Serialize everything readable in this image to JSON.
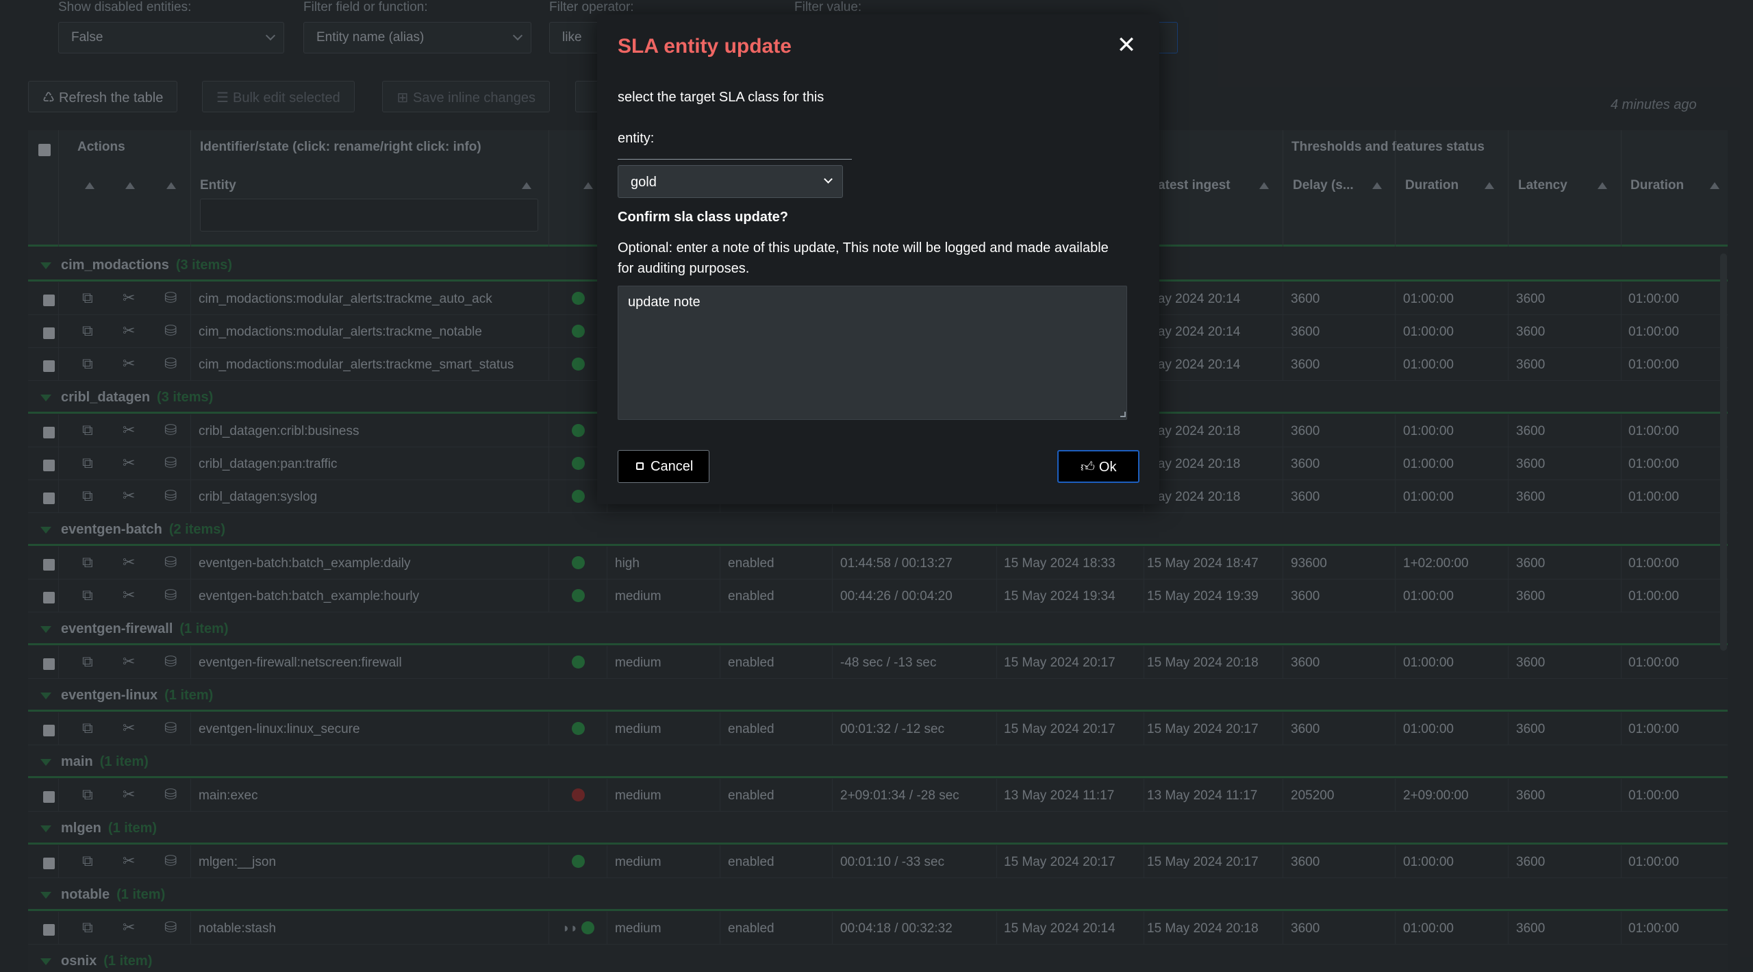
{
  "filters": {
    "show_disabled": {
      "label": "Show disabled entities:",
      "value": "False"
    },
    "filter_field": {
      "label": "Filter field or function:",
      "value": "Entity name (alias)"
    },
    "filter_operator": {
      "label": "Filter operator:",
      "value": "like"
    },
    "filter_value": {
      "label": "Filter value:",
      "value": ""
    }
  },
  "toolbar": {
    "refresh": "Refresh the table",
    "bulk_edit": "Bulk edit selected",
    "save_inline": "Save inline changes",
    "updated": "4 minutes ago"
  },
  "table": {
    "header": {
      "actions": "Actions",
      "identifier": "Identifier/state (click: rename/right click: info)",
      "thresholds": "Thresholds and features status",
      "entity": "Entity",
      "latest_ingest": "atest ingest",
      "delay": "Delay (s...",
      "duration": "Duration",
      "latency": "Latency",
      "duration2": "Duration"
    },
    "groups": [
      {
        "name": "cim_modactions",
        "count": "(3 items)",
        "rows": [
          {
            "entity": "cim_modactions:modular_alerts:trackme_auto_ack",
            "status": "green",
            "priority": "",
            "monitored": "",
            "lag": "",
            "last_event": "",
            "latest_ingest": "May 2024 20:14",
            "delay": "3600",
            "duration": "01:00:00",
            "latency": "3600",
            "duration2": "01:00:00"
          },
          {
            "entity": "cim_modactions:modular_alerts:trackme_notable",
            "status": "green",
            "priority": "",
            "monitored": "",
            "lag": "",
            "last_event": "",
            "latest_ingest": "May 2024 20:14",
            "delay": "3600",
            "duration": "01:00:00",
            "latency": "3600",
            "duration2": "01:00:00"
          },
          {
            "entity": "cim_modactions:modular_alerts:trackme_smart_status",
            "status": "green",
            "priority": "",
            "monitored": "",
            "lag": "",
            "last_event": "",
            "latest_ingest": "May 2024 20:14",
            "delay": "3600",
            "duration": "01:00:00",
            "latency": "3600",
            "duration2": "01:00:00"
          }
        ]
      },
      {
        "name": "cribl_datagen",
        "count": "(3 items)",
        "rows": [
          {
            "entity": "cribl_datagen:cribl:business",
            "status": "green",
            "priority": "",
            "monitored": "",
            "lag": "",
            "last_event": "",
            "latest_ingest": "May 2024 20:18",
            "delay": "3600",
            "duration": "01:00:00",
            "latency": "3600",
            "duration2": "01:00:00"
          },
          {
            "entity": "cribl_datagen:pan:traffic",
            "status": "green",
            "priority": "",
            "monitored": "",
            "lag": "",
            "last_event": "",
            "latest_ingest": "May 2024 20:18",
            "delay": "3600",
            "duration": "01:00:00",
            "latency": "3600",
            "duration2": "01:00:00"
          },
          {
            "entity": "cribl_datagen:syslog",
            "status": "green",
            "priority": "",
            "monitored": "",
            "lag": "",
            "last_event": "",
            "latest_ingest": "May 2024 20:18",
            "delay": "3600",
            "duration": "01:00:00",
            "latency": "3600",
            "duration2": "01:00:00"
          }
        ]
      },
      {
        "name": "eventgen-batch",
        "count": "(2 items)",
        "rows": [
          {
            "entity": "eventgen-batch:batch_example:daily",
            "status": "green",
            "priority": "high",
            "monitored": "enabled",
            "lag": "01:44:58 / 00:13:27",
            "last_event": "15 May 2024 18:33",
            "latest_ingest": "15 May 2024 18:47",
            "delay": "93600",
            "duration": "1+02:00:00",
            "latency": "3600",
            "duration2": "01:00:00"
          },
          {
            "entity": "eventgen-batch:batch_example:hourly",
            "status": "green",
            "priority": "medium",
            "monitored": "enabled",
            "lag": "00:44:26 / 00:04:20",
            "last_event": "15 May 2024 19:34",
            "latest_ingest": "15 May 2024 19:39",
            "delay": "3600",
            "duration": "01:00:00",
            "latency": "3600",
            "duration2": "01:00:00"
          }
        ]
      },
      {
        "name": "eventgen-firewall",
        "count": "(1 item)",
        "rows": [
          {
            "entity": "eventgen-firewall:netscreen:firewall",
            "status": "green",
            "priority": "medium",
            "monitored": "enabled",
            "lag": "-48 sec / -13 sec",
            "last_event": "15 May 2024 20:17",
            "latest_ingest": "15 May 2024 20:18",
            "delay": "3600",
            "duration": "01:00:00",
            "latency": "3600",
            "duration2": "01:00:00"
          }
        ]
      },
      {
        "name": "eventgen-linux",
        "count": "(1 item)",
        "rows": [
          {
            "entity": "eventgen-linux:linux_secure",
            "status": "green",
            "priority": "medium",
            "monitored": "enabled",
            "lag": "00:01:32 / -12 sec",
            "last_event": "15 May 2024 20:17",
            "latest_ingest": "15 May 2024 20:17",
            "delay": "3600",
            "duration": "01:00:00",
            "latency": "3600",
            "duration2": "01:00:00"
          }
        ]
      },
      {
        "name": "main",
        "count": "(1 item)",
        "rows": [
          {
            "entity": "main:exec",
            "status": "red",
            "priority": "medium",
            "monitored": "enabled",
            "lag": "2+09:01:34 / -28 sec",
            "last_event": "13 May 2024 11:17",
            "latest_ingest": "13 May 2024 11:17",
            "delay": "205200",
            "duration": "2+09:00:00",
            "latency": "3600",
            "duration2": "01:00:00"
          }
        ]
      },
      {
        "name": "mlgen",
        "count": "(1 item)",
        "rows": [
          {
            "entity": "mlgen:__json",
            "status": "green",
            "priority": "medium",
            "monitored": "enabled",
            "lag": "00:01:10 / -33 sec",
            "last_event": "15 May 2024 20:17",
            "latest_ingest": "15 May 2024 20:17",
            "delay": "3600",
            "duration": "01:00:00",
            "latency": "3600",
            "duration2": "01:00:00"
          }
        ]
      },
      {
        "name": "notable",
        "count": "(1 item)",
        "rows": [
          {
            "entity": "notable:stash",
            "status": "green",
            "priority": "medium",
            "monitored": "enabled",
            "lag": "00:04:18 / 00:32:32",
            "last_event": "15 May 2024 20:14",
            "latest_ingest": "15 May 2024 20:18",
            "delay": "3600",
            "duration": "01:00:00",
            "latency": "3600",
            "duration2": "01:00:00",
            "glasses": true
          }
        ]
      },
      {
        "name": "osnix",
        "count": "(1 item)",
        "rows": []
      }
    ]
  },
  "modal": {
    "title": "SLA entity update",
    "prompt_line1": "select the target SLA class for this",
    "prompt_line2": "entity:",
    "sla_value": "gold",
    "confirm": "Confirm sla class update?",
    "optional_line1": "Optional: enter a note of this update, This note will be logged and made available",
    "optional_line2": "for auditing purposes.",
    "note_value": "update note",
    "cancel": "Cancel",
    "ok": "Ok"
  },
  "colors": {
    "title_red": "#ef6663",
    "group_green": "#2e7d4a",
    "status_green": "#2e9e4e",
    "status_red": "#a83232",
    "ok_border": "#1d5fbf"
  }
}
